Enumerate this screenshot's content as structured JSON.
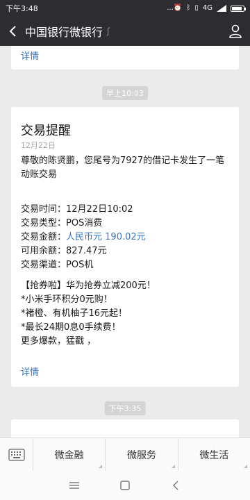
{
  "status_bar": {
    "time": "下午3:48",
    "icons_left": "...",
    "network": "4G",
    "icons_right": [
      "alarm-icon",
      "bluetooth-icon",
      "vibrate-icon",
      "signal-icon",
      "battery-icon"
    ],
    "battery_level": 0.85
  },
  "nav": {
    "title": "中国银行微银行",
    "sub_icon": "ear-icon",
    "back_icon": "back-arrow-icon",
    "profile_icon": "person-icon"
  },
  "messages": {
    "top_detail": "详情",
    "chip1": "早上10:03",
    "card": {
      "title": "交易提醒",
      "date": "12月22日",
      "intro": "尊敬的陈贤鹏，您尾号为7927的借记卡发生了一笔动账交易",
      "rows": [
        {
          "label": "交易时间：",
          "value": "12月22日10:02"
        },
        {
          "label": "交易类型：",
          "value": "POS消费"
        },
        {
          "label": "交易金额：",
          "value": "人民币元 190.02元"
        },
        {
          "label": "可用余额：",
          "value": "827.47元"
        },
        {
          "label": "交易渠道：",
          "value": "POS机"
        }
      ],
      "promo": [
        "【抢券啦】华为抢券立减200元！",
        "*小米手环积分0元购！",
        "*褚橙、有机柚子16元起！",
        "*最长24期0息0手续费！",
        "更多爆款，猛戳 ，"
      ],
      "detail": "详情"
    },
    "chip2": "下午3:35"
  },
  "bottom_menu": {
    "keyboard_icon": "keyboard-icon",
    "items": [
      "微金融",
      "微服务",
      "微生活"
    ]
  },
  "system_nav": {
    "menu_icon": "menu-icon",
    "home_icon": "home-icon",
    "back_icon": "back-icon"
  },
  "colors": {
    "bar_bg": "#2c2c31",
    "link_blue": "#3a73b8",
    "page_bg": "#ebebeb"
  }
}
